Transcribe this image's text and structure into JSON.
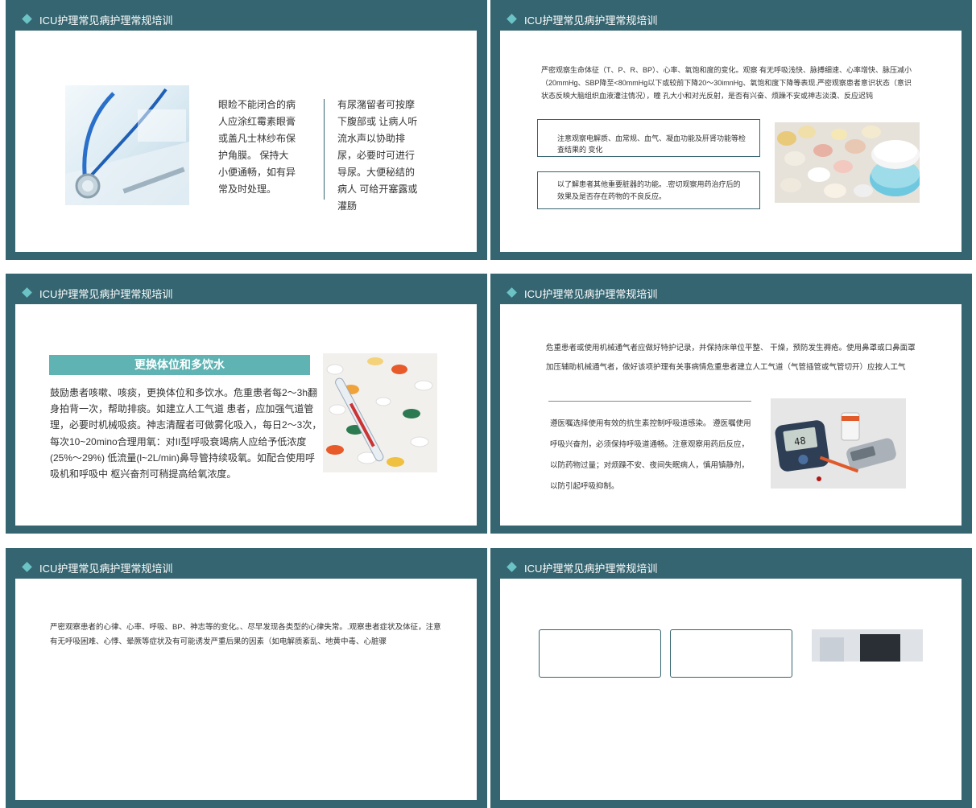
{
  "slide_title": "ICU护理常见病护理常规培训",
  "slide1": {
    "col1": "眼睑不能闭合的病人应涂红霉素眼膏或盖凡士林纱布保护角膜。 保持大小便通畅，如有异常及时处理。",
    "col2": "有尿潴留者可按摩下腹部或 让病人听流水声以协助排尿，必要时可进行导尿。大便秘结的病人 可给开塞露或灌肠",
    "image_icon": "stethoscope-icon"
  },
  "slide2": {
    "paragraph": "严密观察生命体征（T、P、R、BP）、心率、氧饱和度的变化。观察 有无呼吸浅快、脉搏细速、心率增快、脉压减小（20mmHg、SBP降至<80mmHg以下或较前下降20～30imnHg、氧饱和度下降等表现.严密观察患者意识状态（意识状态反映大脑组织血液灌注情况），瞳 孔大小和对光反射，是否有兴奋、烦躁不安或神志淡漠、反应迟钝",
    "box1": "注意观察电解质、血常规、血气、凝血功能及肝肾功能等检查结果的 变化",
    "box2": "以了解患者其他重要脏器的功能。.密切观察用药治疗后的效果及是否存在药物的不良反应。",
    "image_icon": "pills-icon"
  },
  "slide3": {
    "heading": "更换体位和多饮水",
    "paragraph": "鼓励患者咳嗽、咳痰，更换体位和多饮水。危重患者每2～3h翻身拍背一次，帮助排痰。如建立人工气道 患者，应加强气道管理，必要时机械吸痰。神志清醒者可做雾化吸入，每日2～3次，每次10~20mino合理用氧：对II型呼吸衰竭病人应给予低浓度(25%～29%) 低流量(l~2L/min)鼻导管持续吸氧。如配合使用呼吸机和呼吸中 枢兴奋剂可稍提高给氧浓度。",
    "image_icon": "thermometer-pills-icon"
  },
  "slide4": {
    "paragraph1": "危重患者或使用机械通气者应做好特护记录，并保持床单位平整、 干燥，预防发生褥疮。使用鼻罩或口鼻面罩加压辅助机械通气者，做好该项护理有关事病情危重患者建立人工气道（气管插管或气管切开）应按人工气",
    "paragraph2": "遵医嘱选择使用有效的抗生素控制呼吸道感染。 遵医嘱使用呼吸兴奋剂，必须保持呼吸道通畅。注意观察用药后反应，以防药物过量；对烦躁不安、夜间失眠病人，慎用镇静剂，以防引起呼吸抑制。",
    "meter_reading": "48",
    "image_icon": "glucose-meter-icon"
  },
  "slide5": {
    "paragraph": "严密观察患者的心律、心率、呼吸、BP、神志等的变化。、尽早发现各类型的心律失常。.观察患者症状及体征，注意有无呼吸困难、心悸、晕厥等症状及有可能诱发严重后果的因素（如电解质紊乱、地黄中毒、心脏骤"
  },
  "colors": {
    "frame": "#356570",
    "accent": "#5fb3b3",
    "text": "#333333"
  }
}
